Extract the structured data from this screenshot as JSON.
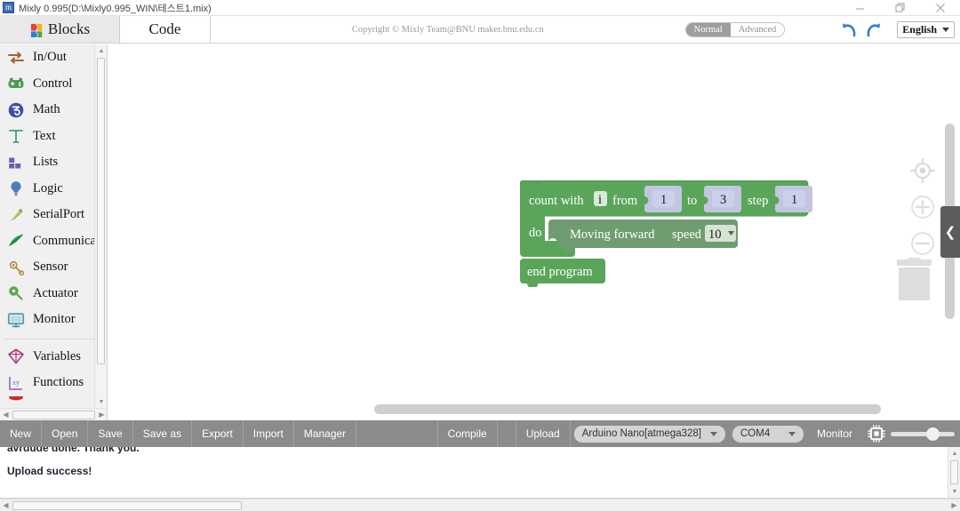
{
  "window": {
    "title": "Mixly 0.995(D:\\Mixly0.995_WIN\\테스트1.mix)",
    "app_icon": "mixly-app-icon",
    "minimize": "—",
    "restore": "❐",
    "close": "✕"
  },
  "header": {
    "tabs": [
      {
        "label": "Blocks",
        "icon": "puzzle-icon",
        "active": true
      },
      {
        "label": "Code",
        "icon": "",
        "active": false
      }
    ],
    "copyright": "Copyright © Mixly Team@BNU maker.bnu.edu.cn",
    "mode_toggle": {
      "options": [
        "Normal",
        "Advanced"
      ],
      "selected": "Normal"
    },
    "undo": "undo-icon",
    "redo": "redo-icon",
    "language": {
      "value": "English"
    }
  },
  "sidebar": {
    "items": [
      {
        "label": "In/Out",
        "icon": "inout-icon",
        "color": "#9c6b4a"
      },
      {
        "label": "Control",
        "icon": "gamepad-icon",
        "color": "#4f9a52"
      },
      {
        "label": "Math",
        "icon": "math-icon",
        "color": "#3b4fa8"
      },
      {
        "label": "Text",
        "icon": "text-icon",
        "color": "#3f9c8c"
      },
      {
        "label": "Lists",
        "icon": "lists-icon",
        "color": "#6b5fb5"
      },
      {
        "label": "Logic",
        "icon": "bulb-icon",
        "color": "#4a80b5"
      },
      {
        "label": "SerialPort",
        "icon": "serialport-icon",
        "color": "#8fae4a"
      },
      {
        "label": "Communicate",
        "icon": "communicate-icon",
        "color": "#2f9c5a"
      },
      {
        "label": "Sensor",
        "icon": "sensor-icon",
        "color": "#b08a3e"
      },
      {
        "label": "Actuator",
        "icon": "actuator-icon",
        "color": "#5aa84a"
      },
      {
        "label": "Monitor",
        "icon": "monitor-icon",
        "color": "#4aa0a8"
      }
    ],
    "items_group2": [
      {
        "label": "Variables",
        "icon": "variables-icon",
        "color": "#b5407f"
      },
      {
        "label": "Functions",
        "icon": "functions-icon",
        "color": "#8a5fb5"
      }
    ],
    "partial_item": {
      "label": "",
      "icon": "red-partial-icon",
      "color": "#d22b2b"
    }
  },
  "workspace": {
    "blocks": {
      "loop": {
        "label_count_with": "count with",
        "variable": "i",
        "label_from": "from",
        "from_value": "1",
        "label_to": "to",
        "to_value": "3",
        "label_step": "step",
        "step_value": "1",
        "label_do": "do",
        "color": "#5ba55b"
      },
      "action": {
        "label": "Moving forward",
        "param_label": "speed",
        "param_value": "10",
        "color": "#6f9c70"
      },
      "end": {
        "label": "end program",
        "color": "#5ba55b"
      }
    },
    "controls": {
      "center": "target-center-icon",
      "zoom_in": "zoom-in-icon",
      "zoom_out": "zoom-out-icon",
      "trash": "trash-icon",
      "collapse": "chevron-left-icon"
    }
  },
  "toolbar": {
    "file_buttons": [
      "New",
      "Open",
      "Save",
      "Save as",
      "Export",
      "Import",
      "Manager"
    ],
    "compile": "Compile",
    "upload": "Upload",
    "board": {
      "value": "Arduino Nano[atmega328]"
    },
    "port": {
      "value": "COM4"
    },
    "monitor": "Monitor",
    "chip_icon": "chip-icon",
    "slider_value": 55
  },
  "console": {
    "lines": [
      "avrdude done.  Thank you.",
      "Upload success!"
    ]
  },
  "colors": {
    "toolbar_bg": "#8b8b8b",
    "block_green": "#5ba55b",
    "block_green_dark": "#6f9c70",
    "field_lavender": "#c3c6e0",
    "accent_blue": "#3b7fd4"
  }
}
